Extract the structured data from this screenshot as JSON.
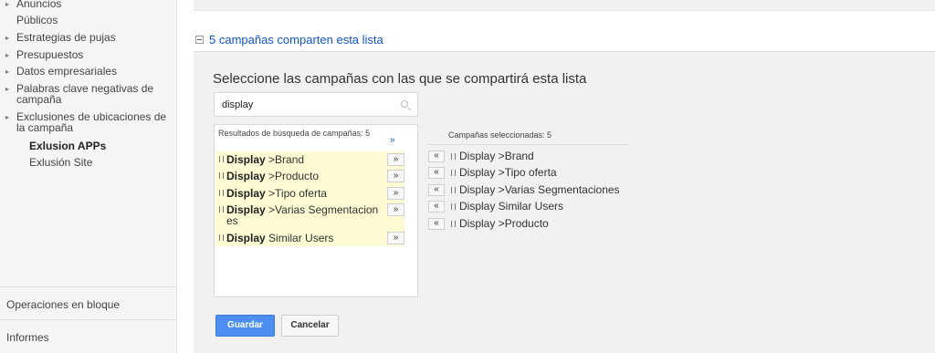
{
  "sidebar": {
    "items": [
      {
        "label": "Anuncios"
      },
      {
        "label": "Públicos"
      },
      {
        "label": "Estrategias de pujas"
      },
      {
        "label": "Presupuestos"
      },
      {
        "label": "Datos empresariales"
      },
      {
        "label": "Palabras clave negativas de campaña"
      },
      {
        "label": "Exclusiones de ubicaciones de la campaña"
      },
      {
        "label": "Exlusion APPs"
      },
      {
        "label": "Exlusión Site"
      }
    ],
    "bottom": {
      "bulk_ops": "Operaciones en bloque",
      "reports": "Informes"
    }
  },
  "section": {
    "title": "5 campañas comparten esta lista"
  },
  "panel": {
    "heading": "Seleccione las campañas con las que se compartirá esta lista",
    "search": {
      "value": "display",
      "placeholder": ""
    },
    "results": {
      "header": "Resultados de búsqueda de campañas: 5",
      "add_all": "»",
      "rows": [
        {
          "bold": "Display",
          "rest": " >Brand",
          "button": "»"
        },
        {
          "bold": "Display",
          "rest": " >Producto",
          "button": "»"
        },
        {
          "bold": "Display",
          "rest": " >Tipo oferta",
          "button": "»"
        },
        {
          "bold": "Display",
          "rest": " >Varias Segmentaciones",
          "button": "»"
        },
        {
          "bold": "Display",
          "rest": " Similar Users",
          "button": "»"
        }
      ]
    },
    "selected": {
      "header": "Campañas seleccionadas: 5",
      "rows": [
        {
          "label": "Display >Brand",
          "button": "«"
        },
        {
          "label": "Display >Tipo oferta",
          "button": "«"
        },
        {
          "label": "Display >Varias Segmentaciones",
          "button": "«"
        },
        {
          "label": "Display Similar Users",
          "button": "«"
        },
        {
          "label": "Display >Producto",
          "button": "«"
        }
      ]
    },
    "buttons": {
      "save": "Guardar",
      "cancel": "Cancelar"
    }
  }
}
